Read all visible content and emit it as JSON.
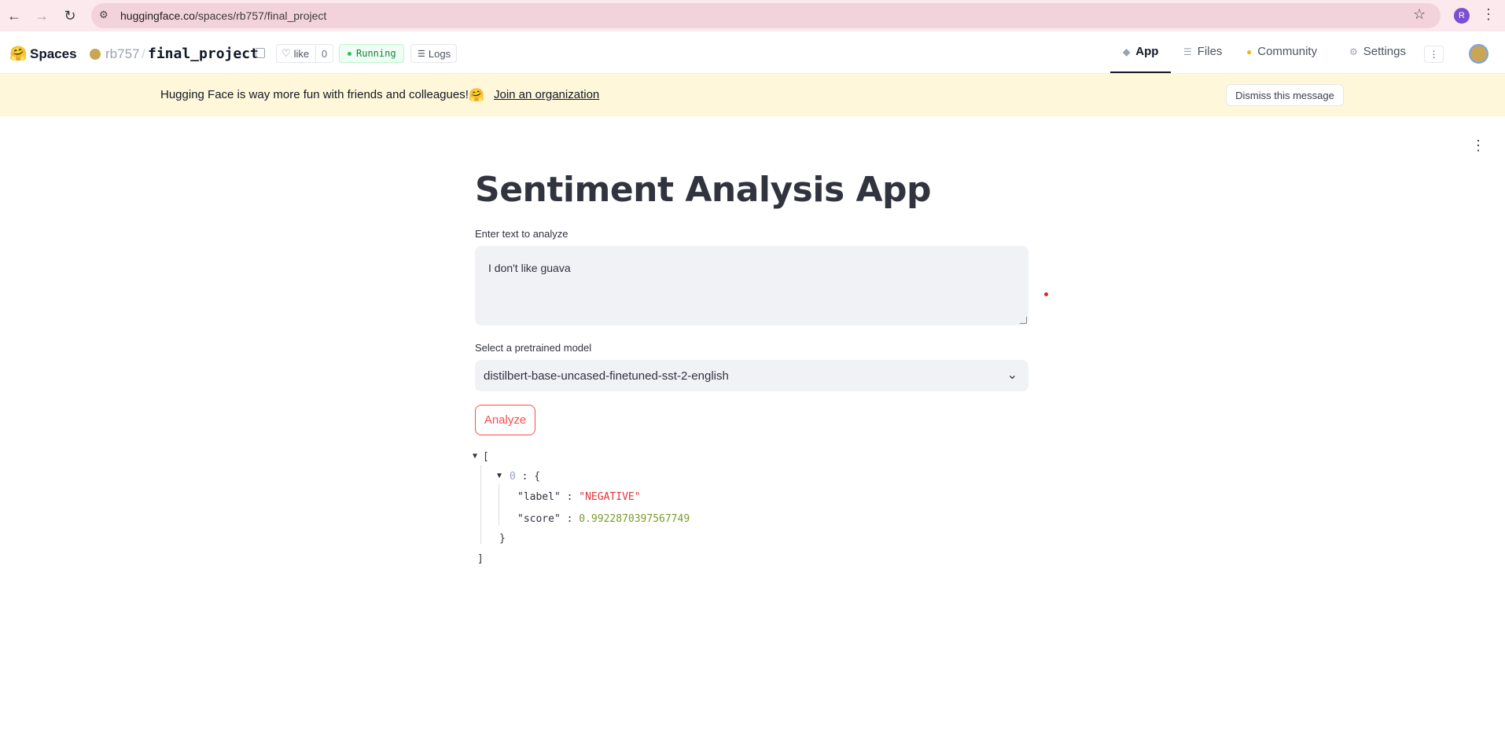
{
  "browser": {
    "url_host": "huggingface.co",
    "url_path": "/spaces/rb757/final_project",
    "profile_initial": "R"
  },
  "header": {
    "spaces_label": "Spaces",
    "owner": "rb757",
    "repo": "final_project",
    "like_label": "like",
    "like_count": "0",
    "status": "Running",
    "logs_label": "Logs",
    "tabs": [
      {
        "label": "App",
        "icon": "app-cube-icon",
        "active": true
      },
      {
        "label": "Files",
        "icon": "files-icon",
        "active": false
      },
      {
        "label": "Community",
        "icon": "community-icon",
        "active": false
      },
      {
        "label": "Settings",
        "icon": "gear-icon",
        "active": false
      }
    ]
  },
  "banner": {
    "text": "Hugging Face is way more fun with friends and colleagues!",
    "link": "Join an organization",
    "dismiss": "Dismiss this message"
  },
  "app": {
    "title": "Sentiment Analysis App",
    "text_label": "Enter text to analyze",
    "text_value": "I don't like guava",
    "model_label": "Select a pretrained model",
    "model_value": "distilbert-base-uncased-finetuned-sst-2-english",
    "analyze_label": "Analyze",
    "accent_color": "#ff4b4b"
  },
  "result": {
    "index": "0",
    "label_key": "\"label\"",
    "label_value": "\"NEGATIVE\"",
    "score_key": "\"score\"",
    "score_value": "0.9922870397567749"
  }
}
